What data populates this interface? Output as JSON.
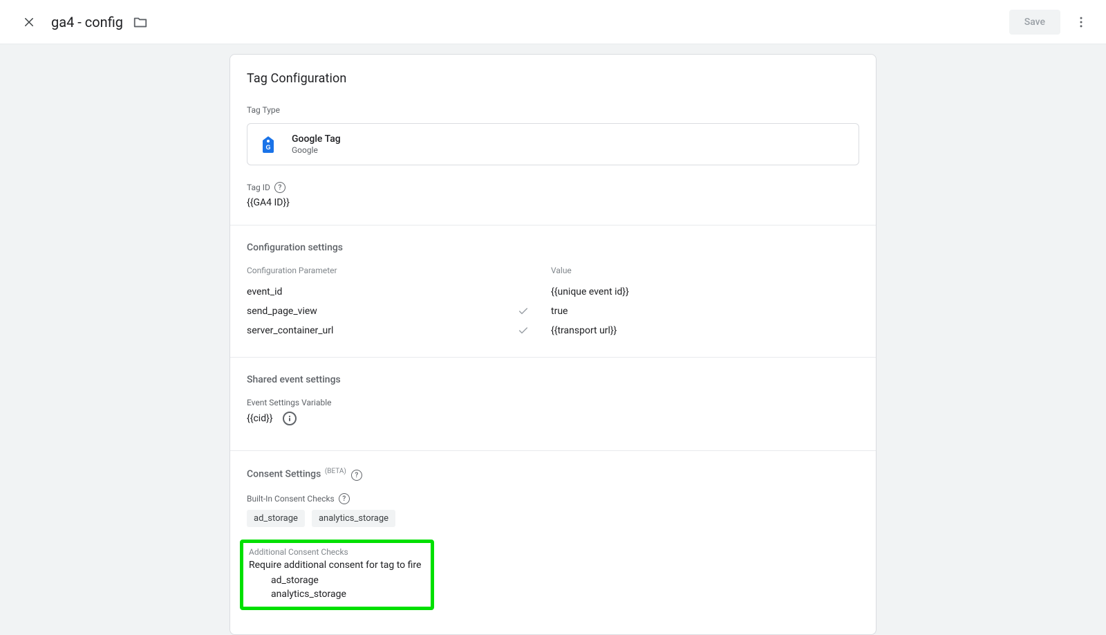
{
  "header": {
    "title": "ga4 - config",
    "save_label": "Save"
  },
  "card": {
    "title": "Tag Configuration",
    "tag_type_label": "Tag Type",
    "tag_type_name": "Google Tag",
    "tag_type_vendor": "Google",
    "tag_id_label": "Tag ID",
    "tag_id_value": "{{GA4 ID}}"
  },
  "config": {
    "title": "Configuration settings",
    "col_param": "Configuration Parameter",
    "col_value": "Value",
    "rows": [
      {
        "param": "event_id",
        "check": false,
        "value": "{{unique event id}}"
      },
      {
        "param": "send_page_view",
        "check": true,
        "value": "true"
      },
      {
        "param": "server_container_url",
        "check": true,
        "value": "{{transport url}}"
      }
    ]
  },
  "shared": {
    "title": "Shared event settings",
    "label": "Event Settings Variable",
    "value": "{{cid}}"
  },
  "consent": {
    "title": "Consent Settings",
    "badge": "(BETA)",
    "builtin_label": "Built-In Consent Checks",
    "builtin_chips": [
      "ad_storage",
      "analytics_storage"
    ],
    "additional_label": "Additional Consent Checks",
    "additional_desc": "Require additional consent for tag to fire",
    "additional_items": [
      "ad_storage",
      "analytics_storage"
    ]
  }
}
